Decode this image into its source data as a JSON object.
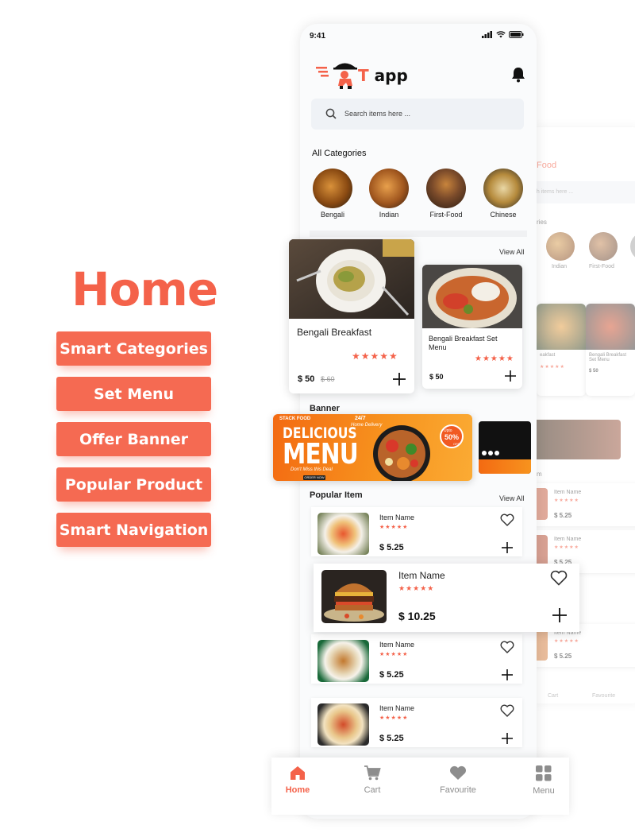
{
  "promo": {
    "title": "Home",
    "features": [
      "Smart Categories",
      "Set Menu",
      "Offer Banner",
      "Popular Product",
      "Smart Navigation"
    ]
  },
  "status": {
    "time": "9:41"
  },
  "app": {
    "logo_letter": "T",
    "logo_word": "app"
  },
  "search": {
    "placeholder": "Search items here ..."
  },
  "categories": {
    "title": "All Categories",
    "items": [
      "Bengali",
      "Indian",
      "First-Food",
      "Chinese"
    ]
  },
  "set_menu": {
    "view_all": "View All",
    "cards": [
      {
        "name": "Bengali Breakfast",
        "price": "$ 50",
        "old_price": "$ 60",
        "stars": "★★★★★"
      },
      {
        "name": "Bengali Breakfast Set Menu",
        "price": "$ 50",
        "stars": "★★★★★"
      }
    ]
  },
  "banner": {
    "title": "Banner",
    "brand": "STACK FOOD",
    "headline1": "DELICIOUS",
    "headline2": "MENU",
    "tagline": "Don't Miss this Deal",
    "badge": "24/7",
    "badge_sub": "Home Delivery",
    "discount": "50%",
    "discount_label": "Upto",
    "discount_sub": "OFF",
    "cta": "ORDER NOW"
  },
  "popular": {
    "title": "Popular Item",
    "view_all": "View All",
    "items": [
      {
        "name": "Item Name",
        "stars": "★★★★★",
        "price": "$ 5.25"
      },
      {
        "name": "Item Name",
        "stars": "★★★★★",
        "price": "$ 10.25"
      },
      {
        "name": "Item Name",
        "stars": "★★★★★",
        "price": "$ 5.25"
      },
      {
        "name": "Item Name",
        "stars": "★★★★★",
        "price": "$ 5.25"
      }
    ]
  },
  "nav": {
    "items": [
      {
        "label": "Home",
        "icon": "home-icon"
      },
      {
        "label": "Cart",
        "icon": "cart-icon"
      },
      {
        "label": "Favourite",
        "icon": "heart-icon"
      },
      {
        "label": "Menu",
        "icon": "grid-icon"
      }
    ]
  },
  "back_phone": {
    "title": "Food",
    "search_placeholder": "rch items here ...",
    "categories_title": "ries",
    "cat_labels": [
      "Indian",
      "First-Food"
    ],
    "card_labels": [
      "eakfast",
      "Bengali Breakfast Set Menu"
    ],
    "card_price": "$ 50",
    "list_label": "m",
    "items": [
      {
        "name": "Item Name",
        "price": "$ 5.25"
      },
      {
        "name": "Item Name",
        "price": "$ 5.25"
      },
      {
        "name": "Item Name",
        "price": "$ 5.25"
      }
    ],
    "nav": [
      "Cart",
      "Favourite"
    ]
  },
  "colors": {
    "accent": "#f4624a",
    "feature_bg": "#f56a52",
    "banner_orange": "#f36a12"
  }
}
